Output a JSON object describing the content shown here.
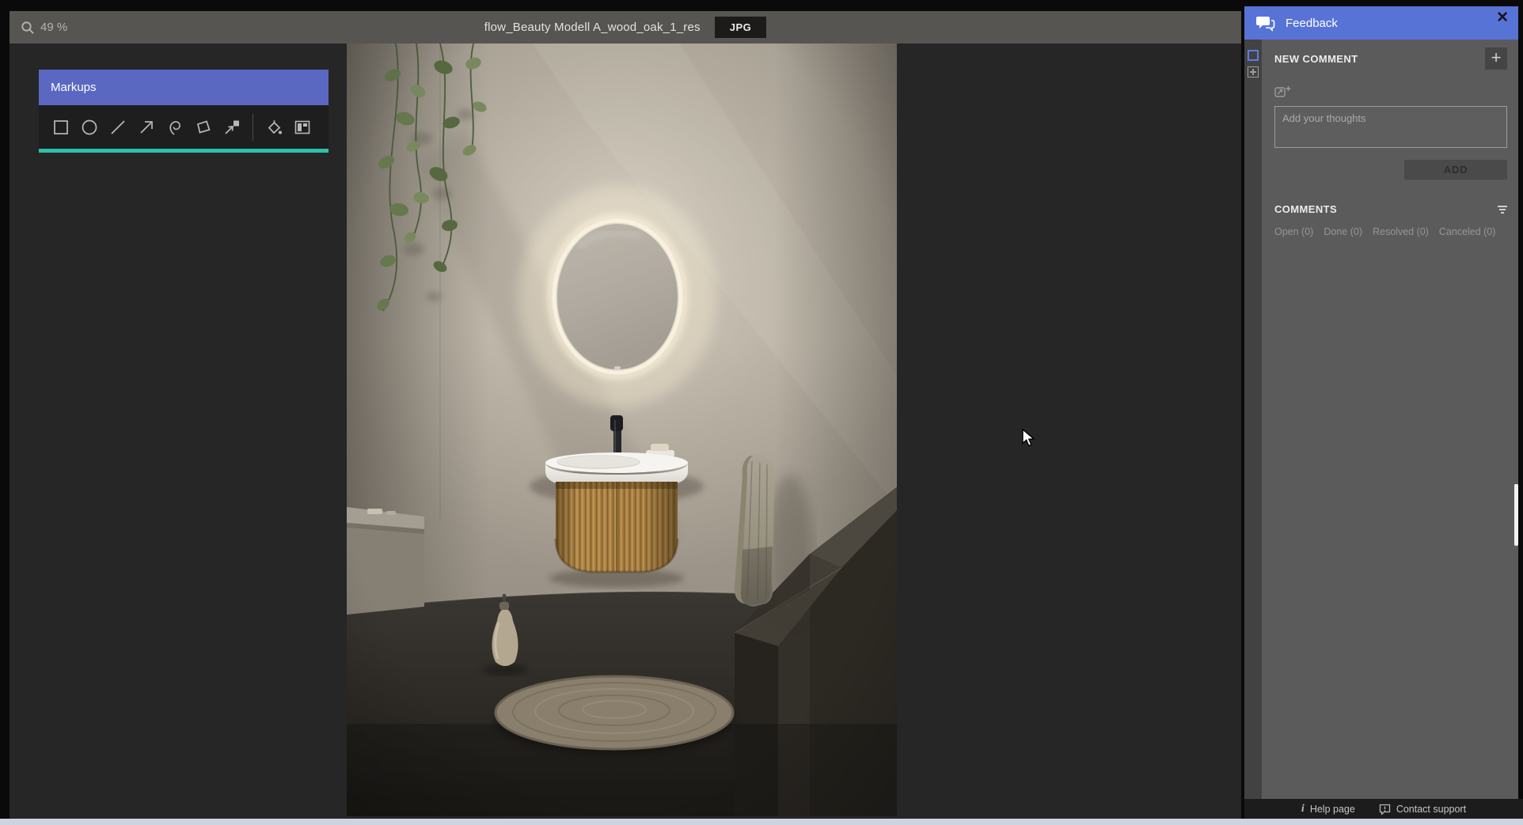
{
  "topbar": {
    "zoom_value": "49 %",
    "document_title": "flow_Beauty Modell A_wood_oak_1_res",
    "format_badge": "JPG"
  },
  "markups_panel": {
    "title": "Markups",
    "tools": [
      "rectangle",
      "ellipse",
      "line",
      "arrow",
      "freehand",
      "polygon",
      "pin",
      "fill-color",
      "compare"
    ]
  },
  "feedback_panel": {
    "title": "Feedback",
    "new_comment": {
      "heading": "NEW COMMENT",
      "placeholder": "Add your thoughts",
      "add_button": "ADD"
    },
    "comments": {
      "heading": "COMMENTS",
      "filters": [
        "Open (0)",
        "Done (0)",
        "Resolved (0)",
        "Canceled (0)"
      ]
    },
    "footer": {
      "help_label": "Help page",
      "contact_label": "Contact support"
    }
  },
  "icons": {
    "close": "✕",
    "plus": "+",
    "help": "i"
  },
  "colors": {
    "markups_header_blue": "#5a68c2",
    "feedback_header_blue": "#5873d6",
    "teal_underline": "#2fc0ab",
    "topbar_gray": "#575552",
    "panel_gray": "#5b5b5b",
    "canvas_dark": "#262626",
    "toolbar_dark": "#1e1e1e",
    "footer_dark": "#1c1c1c",
    "badge_bg": "#1d1b19",
    "bottom_strip": "#ccd5df"
  }
}
